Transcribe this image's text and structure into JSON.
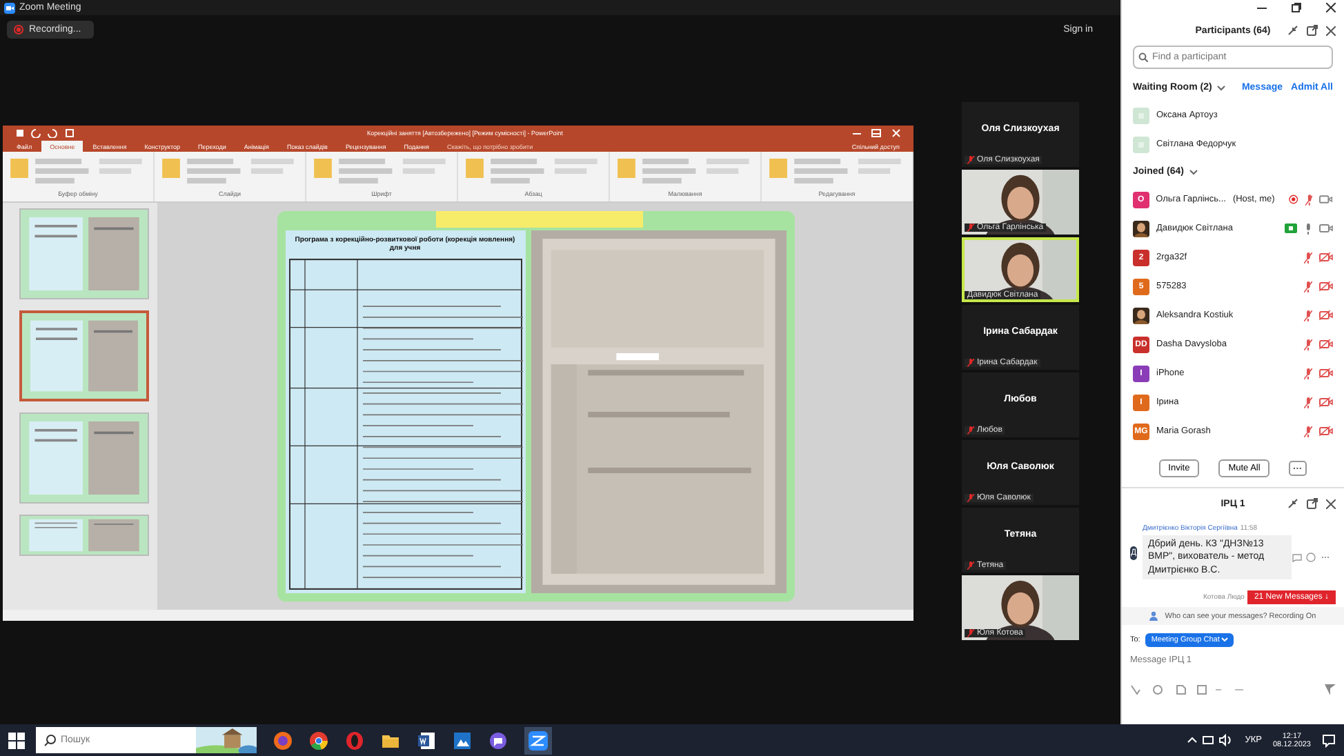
{
  "zoom_window": {
    "title": "Zoom Meeting",
    "recording": "Recording...",
    "sign_in": "Sign in"
  },
  "shared_screen": {
    "title": "Корекційні заняття [Автозбережено] [Режим сумісності] - PowerPoint",
    "tabs": [
      {
        "label": "Файл",
        "selected": false
      },
      {
        "label": "Основне",
        "selected": true
      },
      {
        "label": "Вставлення",
        "selected": false
      },
      {
        "label": "Конструктор",
        "selected": false
      },
      {
        "label": "Переходи",
        "selected": false
      },
      {
        "label": "Анімація",
        "selected": false
      },
      {
        "label": "Показ слайдів",
        "selected": false
      },
      {
        "label": "Рецензування",
        "selected": false
      },
      {
        "label": "Подання",
        "selected": false
      }
    ],
    "tell_me": "Скажіть, що потрібно зробити",
    "share": "Спільний доступ",
    "ribbon_groups": [
      "Буфер обміну",
      "Слайди",
      "Шрифт",
      "Абзац",
      "Малювання",
      "Редагування"
    ],
    "slide_title": "Програма з корекційно-розвиткової роботи (корекція мовлення) для учня"
  },
  "gallery": [
    {
      "kind": "name",
      "title": "Оля Слизкоухая",
      "label": "Оля Слизкоухая",
      "muted": true,
      "speaking": false
    },
    {
      "kind": "video",
      "label": "Ольга Гарлінська",
      "muted": true,
      "speaking": false
    },
    {
      "kind": "video",
      "label": "Давидюк Світлана",
      "muted": false,
      "speaking": true
    },
    {
      "kind": "name",
      "title": "Ірина Сабардак",
      "label": "Ірина Сабардак",
      "muted": true,
      "speaking": false
    },
    {
      "kind": "name",
      "title": "Любов",
      "label": "Любов",
      "muted": true,
      "speaking": false
    },
    {
      "kind": "name",
      "title": "Юля Саволюк",
      "label": "Юля Саволюк",
      "muted": true,
      "speaking": false
    },
    {
      "kind": "name",
      "title": "Тетяна",
      "label": "Тетяна",
      "muted": true,
      "speaking": false
    },
    {
      "kind": "video",
      "label": "Юля Котова",
      "muted": true,
      "speaking": false
    }
  ],
  "participants": {
    "title": "Participants (64)",
    "search": {
      "placeholder": "Find a participant"
    },
    "waiting_room": {
      "label": "Waiting Room (2)",
      "message": "Message",
      "admit_all": "Admit All",
      "people": [
        {
          "name": "Оксана Артоуз"
        },
        {
          "name": "Світлана Федорчук"
        }
      ]
    },
    "joined": {
      "label": "Joined (64)",
      "people": [
        {
          "name": "Ольга Гарлінсь...",
          "role": "(Host, me)",
          "kind": "initials",
          "avatar": "O",
          "color": "#e0306f",
          "recording": true,
          "sharing": false,
          "muted": true,
          "video_off": false
        },
        {
          "name": "Давидюк Світлана",
          "recording": false,
          "sharing": true,
          "muted": false,
          "video_off": false
        },
        {
          "name": "2rga32f",
          "kind": "initials",
          "avatar": "2",
          "color": "#c9302c",
          "recording": false,
          "sharing": false,
          "muted": true,
          "video_off": true
        },
        {
          "name": "575283",
          "kind": "initials",
          "avatar": "5",
          "color": "#e06a1b",
          "recording": false,
          "sharing": false,
          "muted": true,
          "video_off": true
        },
        {
          "name": "Aleksandra Kostiuk",
          "recording": false,
          "sharing": false,
          "muted": true,
          "video_off": true
        },
        {
          "name": "Dasha Davysloba",
          "kind": "initials",
          "avatar": "DD",
          "color": "#c9302c",
          "recording": false,
          "sharing": false,
          "muted": true,
          "video_off": true
        },
        {
          "name": "iPhone",
          "kind": "initials",
          "avatar": "I",
          "color": "#8a3db6",
          "recording": false,
          "sharing": false,
          "muted": true,
          "video_off": true
        },
        {
          "name": "Ірина",
          "kind": "initials",
          "avatar": "I",
          "color": "#e06a1b",
          "recording": false,
          "sharing": false,
          "muted": true,
          "video_off": true
        },
        {
          "name": "Maria Gorash",
          "kind": "initials",
          "avatar": "MG",
          "color": "#e06a1b",
          "recording": false,
          "sharing": false,
          "muted": true,
          "video_off": true
        }
      ]
    },
    "buttons": [
      "Invite",
      "Mute All"
    ]
  },
  "chat": {
    "title": "IPЦ 1",
    "messages": [
      {
        "sender": "Дмитрієнко Вікторія Сергіївна",
        "time": "11:58",
        "avatar": "Д",
        "text": "Дбрий день. КЗ \"ДНЗ№13 ВМР\", вихователь - метод Дмитрієнко В.С."
      }
    ],
    "next_sender": "Котова Людо",
    "new_messages": "21 New Messages ↓",
    "notice": "Who can see your messages? Recording On",
    "to_label": "To:",
    "recipient": "Meeting Group Chat",
    "input": {
      "placeholder": "Message IPЦ 1"
    }
  },
  "taskbar": {
    "search": {
      "placeholder": "Пошук"
    },
    "language": "УКР",
    "time": "12:17",
    "date": "08.12.2023"
  }
}
